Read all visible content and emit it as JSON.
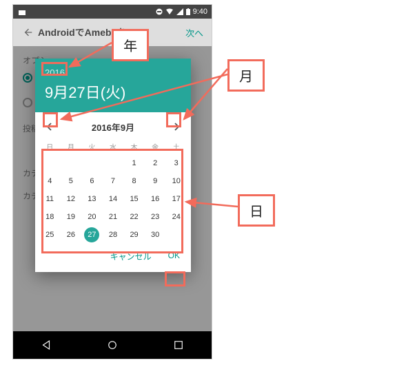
{
  "status": {
    "time": "9:40"
  },
  "appbar": {
    "title": "AndroidでAmebaを…",
    "next": "次へ"
  },
  "bg": {
    "option_label": "オプシ",
    "post_date_label": "投稿日",
    "category_label1": "カテゴ",
    "category_label2": "カテ"
  },
  "picker": {
    "year": "2016",
    "date": "9月27日(火)",
    "month_label": "2016年9月",
    "dow": [
      "日",
      "月",
      "火",
      "水",
      "木",
      "金",
      "土"
    ],
    "weeks": [
      [
        "",
        "",
        "",
        "",
        "1",
        "2",
        "3"
      ],
      [
        "4",
        "5",
        "6",
        "7",
        "8",
        "9",
        "10"
      ],
      [
        "11",
        "12",
        "13",
        "14",
        "15",
        "16",
        "17"
      ],
      [
        "18",
        "19",
        "20",
        "21",
        "22",
        "23",
        "24"
      ],
      [
        "25",
        "26",
        "27",
        "28",
        "29",
        "30",
        ""
      ]
    ],
    "selected": "27",
    "cancel": "キャンセル",
    "ok": "OK"
  },
  "callouts": {
    "year": "年",
    "month": "月",
    "day": "日"
  }
}
